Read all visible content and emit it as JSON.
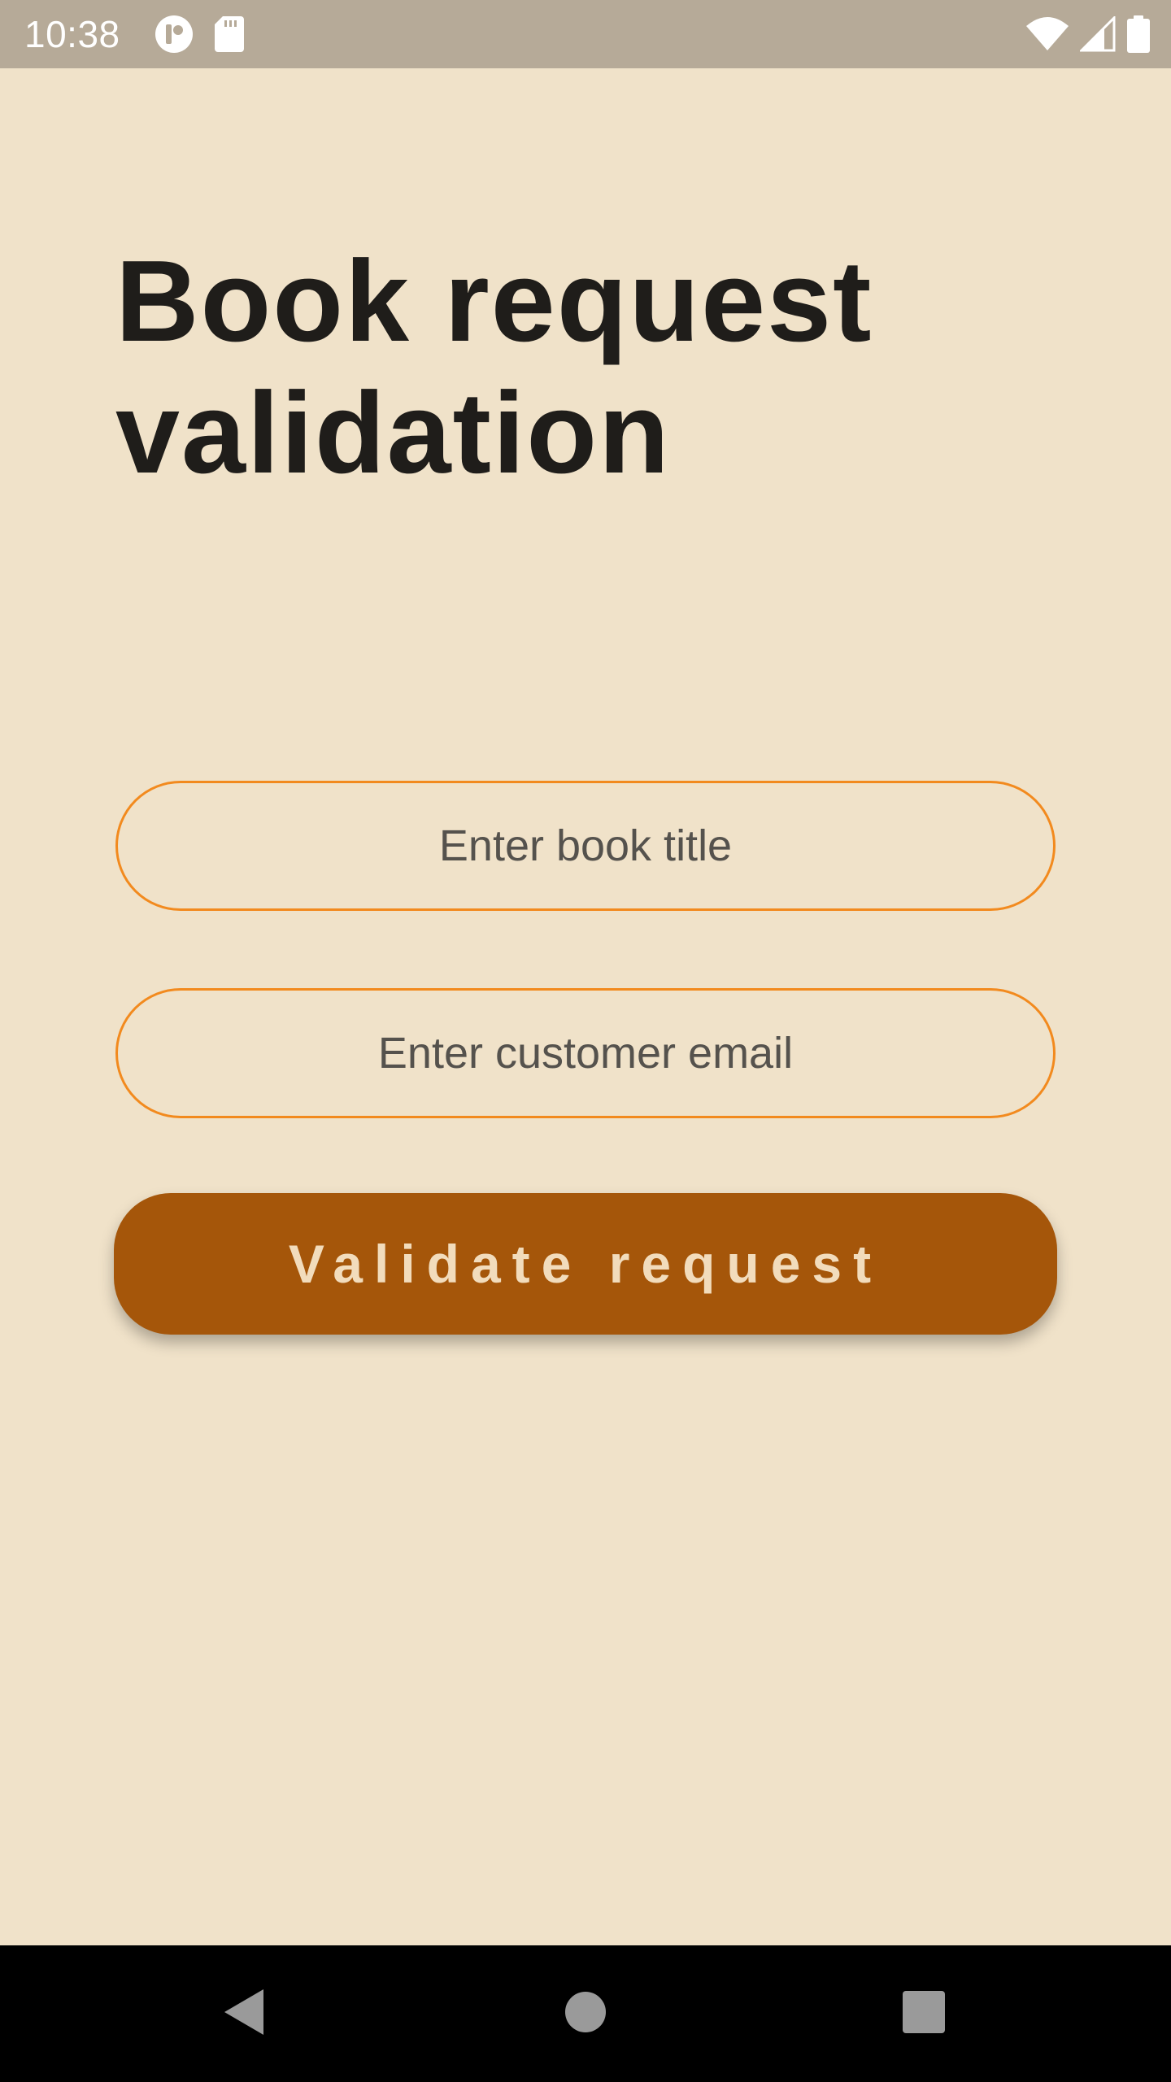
{
  "status_bar": {
    "time": "10:38",
    "left_icons": [
      "app-notification-icon",
      "sd-card-icon"
    ],
    "right_icons": [
      "wifi-icon",
      "cell-signal-icon",
      "battery-icon"
    ]
  },
  "page": {
    "title": "Book request validation"
  },
  "form": {
    "book_title": {
      "value": "",
      "placeholder": "Enter book title"
    },
    "customer_email": {
      "value": "",
      "placeholder": "Enter customer email"
    },
    "validate_label": "Validate request"
  },
  "nav_bar": {
    "buttons": [
      "back-icon",
      "home-icon",
      "recents-icon"
    ]
  },
  "colors": {
    "background": "#f0e2c9",
    "status_bar": "#b6aa98",
    "field_border": "#f28a1e",
    "button_background": "#a5560a",
    "button_text": "#f2dcbc",
    "title_text": "#1f1d1a"
  }
}
